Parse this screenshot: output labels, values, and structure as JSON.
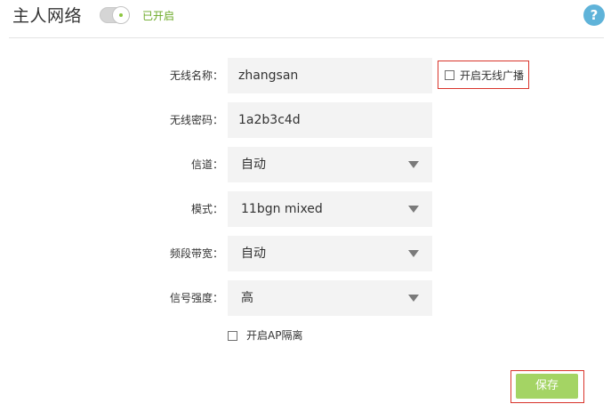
{
  "header": {
    "title": "主人网络",
    "toggle_status": "已开启",
    "help_glyph": "?"
  },
  "form": {
    "ssid": {
      "label": "无线名称：",
      "value": "zhangsan"
    },
    "broadcast": {
      "label": "开启无线广播",
      "checked": false
    },
    "password": {
      "label": "无线密码：",
      "value": "1a2b3c4d"
    },
    "channel": {
      "label": "信道：",
      "value": "自动"
    },
    "mode": {
      "label": "模式：",
      "value": "11bgn mixed"
    },
    "bandwidth": {
      "label": "频段带宽：",
      "value": "自动"
    },
    "signal": {
      "label": "信号强度：",
      "value": "高"
    },
    "ap_isolation": {
      "label": "开启AP隔离",
      "checked": false
    }
  },
  "footer": {
    "save_label": "保存"
  },
  "colors": {
    "accent_green": "#8cc63f",
    "save_button": "#a4d464",
    "help_blue": "#5fb3d9",
    "highlight_red": "#d9342b",
    "field_bg": "#f3f3f3"
  },
  "icons": {
    "help": "help-icon",
    "dropdown": "chevron-down-icon",
    "toggle": "toggle-switch"
  }
}
